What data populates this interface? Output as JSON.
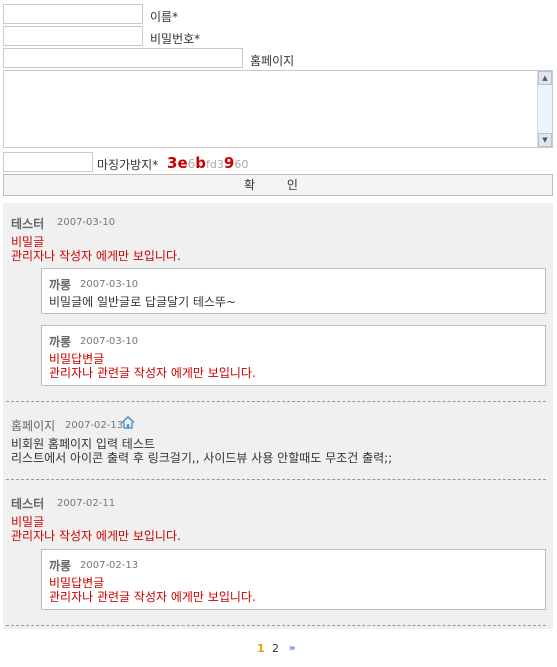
{
  "form": {
    "name_label": "이름*",
    "password_label": "비밀번호*",
    "homepage_label": "홈페이지",
    "captcha_label": "마징가방지*",
    "captcha_chars": [
      {
        "ch": "3",
        "color": "#cc0000"
      },
      {
        "ch": "e",
        "color": "#cc0000"
      },
      {
        "ch": "6",
        "color": "#aaaaaa"
      },
      {
        "ch": "b",
        "color": "#cc0000"
      },
      {
        "ch": "f",
        "color": "#aaaaaa"
      },
      {
        "ch": "d",
        "color": "#aaaaaa"
      },
      {
        "ch": "3",
        "color": "#aaaaaa"
      },
      {
        "ch": "9",
        "color": "#cc0000"
      },
      {
        "ch": "6",
        "color": "#aaaaaa"
      },
      {
        "ch": "0",
        "color": "#aaaaaa"
      }
    ],
    "submit_label": "확 인"
  },
  "comments": [
    {
      "author": "테스터",
      "date": "2007-03-10",
      "lines": [
        "비밀글",
        "관리자나 작성자 에게만 보입니다."
      ],
      "replies": [
        {
          "author": "까롱",
          "date": "2007-03-10",
          "lines": [
            "비밀글에 일반글로 답글달기 테스뚜~"
          ]
        },
        {
          "author": "까롱",
          "date": "2007-03-10",
          "lines": [
            "비밀답변글",
            "관리자나 관련글 작성자 에게만 보입니다."
          ]
        }
      ]
    },
    {
      "author": "홈페이지",
      "date": "2007-02-13",
      "lines": [
        "비회원 홈페이지 입력 테스트",
        "리스트에서 아이콘 출력 후 링크걸기,, 사이드뷰 사용 안할때도 무조건 출력;;"
      ],
      "icon": "home-icon"
    },
    {
      "author": "테스터",
      "date": "2007-02-11",
      "lines": [
        "비밀글",
        "관리자나 작성자 에게만 보입니다."
      ],
      "replies": [
        {
          "author": "까롱",
          "date": "2007-02-13",
          "lines": [
            "비밀답변글",
            "관리자나 관련글 작성자 에게만 보입니다."
          ]
        }
      ]
    }
  ],
  "pagination": {
    "current": "1",
    "pages": [
      "1",
      "2"
    ],
    "next_icon": "double-chevron-right-icon",
    "current_color": "#f0a000",
    "link_color": "#333333",
    "next_color": "#4a7cc8"
  },
  "colors": {
    "secret_text": "#cc0000",
    "comment_bg": "#f0f0f0"
  }
}
